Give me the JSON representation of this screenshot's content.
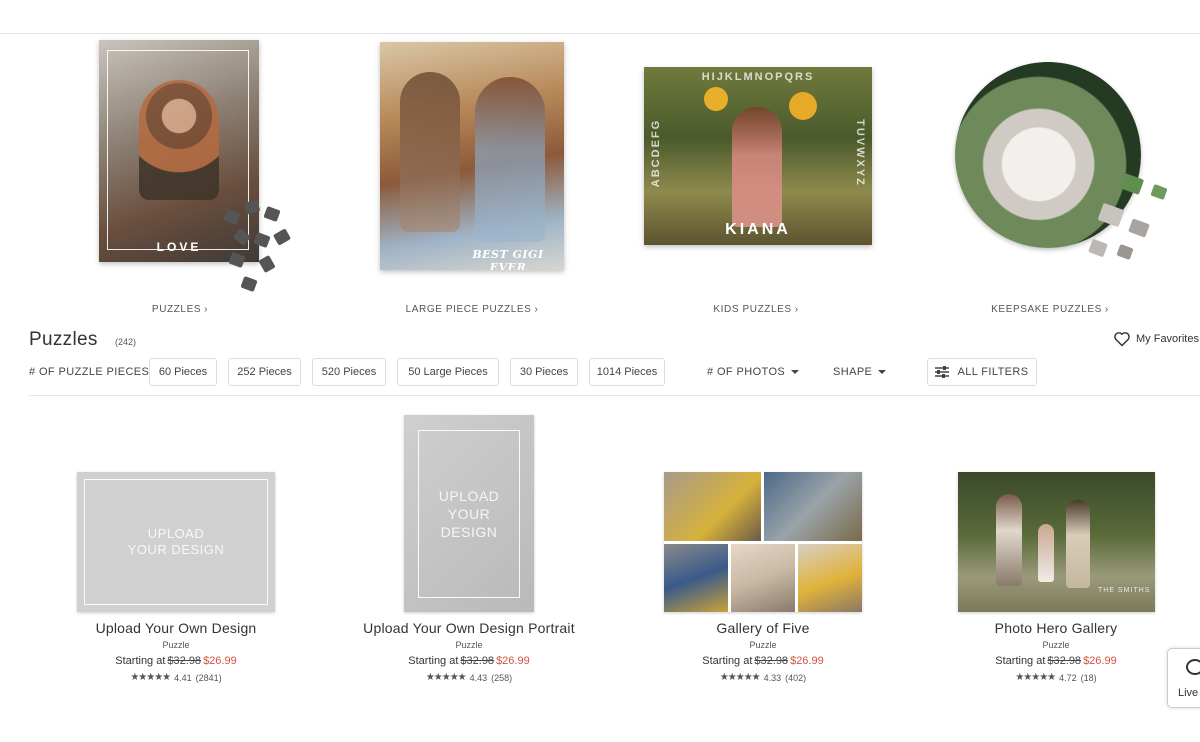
{
  "categories": [
    {
      "label": "PUZZLES",
      "photo_text": "LOVE"
    },
    {
      "label": "LARGE PIECE PUZZLES",
      "photo_text": "BEST GIGI EVER"
    },
    {
      "label": "KIDS PUZZLES",
      "photo_text": "KIANA",
      "top_letters": "HIJKLMNOPQRS",
      "left_letters": "ABCDEFG",
      "right_letters": "TUVWXYZ"
    },
    {
      "label": "KEEPSAKE PUZZLES"
    }
  ],
  "chevron": "›",
  "heading": {
    "title": "Puzzles",
    "count": "(242)"
  },
  "favorites": {
    "label": "My Favorites"
  },
  "filters": {
    "label": "# OF PUZZLE PIECES",
    "chips": [
      "60 Pieces",
      "252 Pieces",
      "520 Pieces",
      "50 Large Pieces",
      "30 Pieces",
      "1014 Pieces"
    ],
    "photos_dropdown": "# OF PHOTOS",
    "shape_dropdown": "SHAPE",
    "all_filters": "ALL FILTERS"
  },
  "products": [
    {
      "title": "Upload Your Own Design",
      "image_text": "UPLOAD\nYOUR DESIGN",
      "type": "Puzzle",
      "price_prefix": "Starting at",
      "old_price": "$32.98",
      "new_price": "$26.99",
      "stars": "★★★★★",
      "rating": "4.41",
      "reviews": "(2841)"
    },
    {
      "title": "Upload Your Own Design Portrait",
      "image_text": "UPLOAD\nYOUR\nDESIGN",
      "type": "Puzzle",
      "price_prefix": "Starting at",
      "old_price": "$32.98",
      "new_price": "$26.99",
      "stars": "★★★★★",
      "rating": "4.43",
      "reviews": "(258)"
    },
    {
      "title": "Gallery of Five",
      "type": "Puzzle",
      "price_prefix": "Starting at",
      "old_price": "$32.98",
      "new_price": "$26.99",
      "stars": "★★★★★",
      "rating": "4.33",
      "reviews": "(402)"
    },
    {
      "title": "Photo Hero Gallery",
      "image_text": "THE SMITHS",
      "type": "Puzzle",
      "price_prefix": "Starting at",
      "old_price": "$32.98",
      "new_price": "$26.99",
      "stars": "★★★★★",
      "rating": "4.72",
      "reviews": "(18)"
    }
  ],
  "live_chat": {
    "label": "Live"
  },
  "colors": {
    "sale_price": "#d0533c",
    "text": "#333333",
    "border": "#dddddd"
  },
  "icons": [
    "heart-icon",
    "sliders-icon",
    "caret-down-icon",
    "chat-bubble-icon",
    "star-icon"
  ]
}
